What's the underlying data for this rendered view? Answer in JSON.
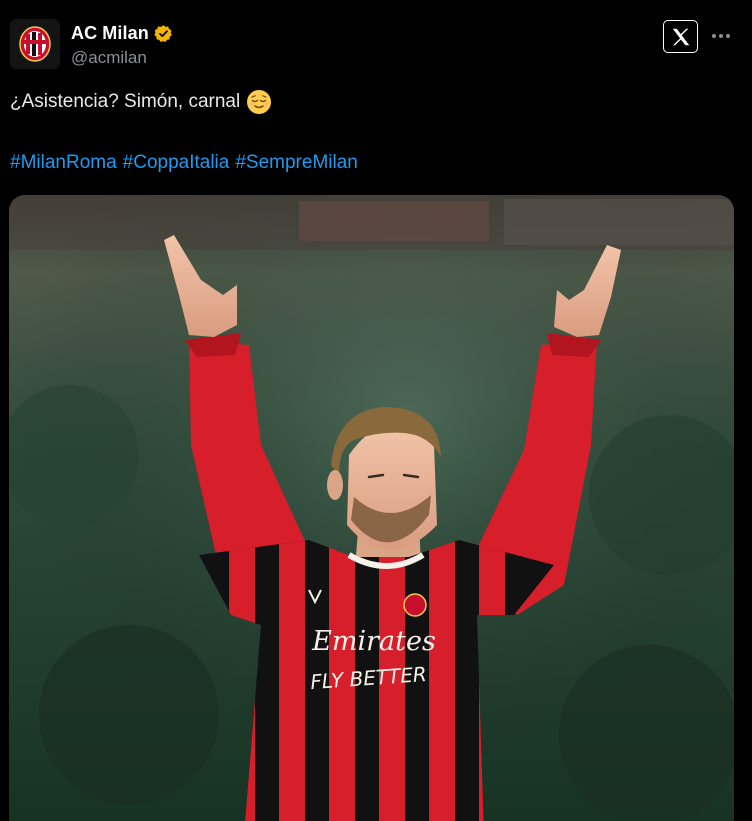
{
  "account": {
    "display_name": "AC Milan",
    "handle": "@acmilan",
    "verified": true,
    "avatar_icon": "ac-milan-crest-icon",
    "verified_icon": "verified-badge-icon",
    "verified_color": "#f4b400"
  },
  "actions": {
    "logo_icon": "x-logo-icon",
    "more_icon": "more-dots-icon"
  },
  "tweet": {
    "text": "¿Asistencia? Simón, carnal",
    "emoji_icon": "relieved-face-emoji-icon",
    "hashtags": [
      "#MilanRoma",
      "#CoppaItalia",
      "#SempreMilan"
    ],
    "hashtag_color": "#1d9bf0"
  },
  "media": {
    "type": "photo",
    "jersey_sponsor_line1": "Emirates",
    "jersey_sponsor_line2": "FLY BETTER",
    "jersey_colors": [
      "#c8102e",
      "#111111"
    ]
  }
}
